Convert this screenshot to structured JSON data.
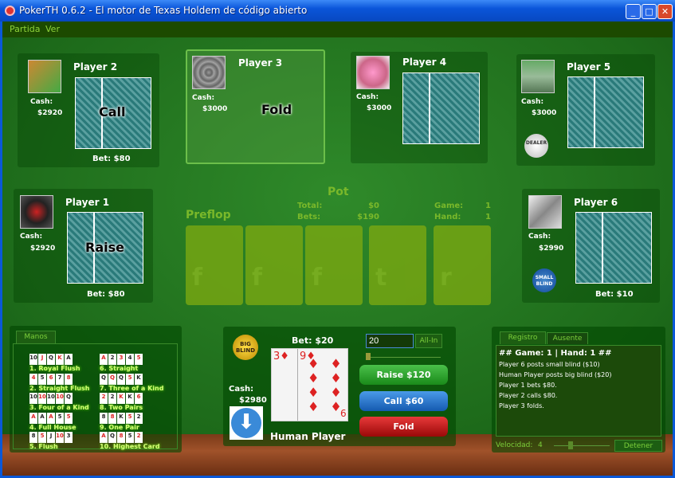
{
  "window": {
    "title": "PokerTH 0.6.2 - El motor de Texas Holdem de código abierto",
    "minimize": "_",
    "maximize": "□",
    "close": "✕"
  },
  "menu": [
    "Partida",
    "Ver"
  ],
  "labels": {
    "cash": "Cash:"
  },
  "players": [
    {
      "name": "Player 1",
      "cash": "$2920",
      "bet": "Bet: $80",
      "action": "Raise"
    },
    {
      "name": "Player 2",
      "cash": "$2920",
      "bet": "Bet: $80",
      "action": "Call"
    },
    {
      "name": "Player 3",
      "cash": "$3000",
      "bet": "",
      "action": "Fold"
    },
    {
      "name": "Player 4",
      "cash": "$3000",
      "bet": "",
      "action": ""
    },
    {
      "name": "Player 5",
      "cash": "$3000",
      "bet": "",
      "action": "",
      "button": "DEALER"
    },
    {
      "name": "Player 6",
      "cash": "$2990",
      "bet": "Bet: $10",
      "action": "",
      "button": "SMALL BLIND"
    }
  ],
  "table": {
    "pot_title": "Pot",
    "round": "Preflop",
    "total_label": "Total:",
    "total": "$0",
    "bets_label": "Bets:",
    "bets": "$190",
    "game_label": "Game:",
    "game": "1",
    "hand_label": "Hand:",
    "hand": "1",
    "board_letters": [
      "f",
      "f",
      "f",
      "t",
      "r"
    ]
  },
  "hands": {
    "tab": "Manos",
    "items": [
      {
        "name": "1. Royal Flush",
        "cards": [
          "10",
          "J",
          "Q",
          "K",
          "A"
        ]
      },
      {
        "name": "2. Straight Flush",
        "cards": [
          "4",
          "5",
          "6",
          "7",
          "8"
        ]
      },
      {
        "name": "3. Four of a Kind",
        "cards": [
          "10",
          "10",
          "10",
          "10",
          "Q"
        ]
      },
      {
        "name": "4. Full House",
        "cards": [
          "A",
          "A",
          "A",
          "5",
          "5"
        ]
      },
      {
        "name": "5. Flush",
        "cards": [
          "8",
          "5",
          "J",
          "10",
          "3"
        ]
      },
      {
        "name": "6. Straight",
        "cards": [
          "A",
          "2",
          "3",
          "4",
          "5"
        ]
      },
      {
        "name": "7. Three of a Kind",
        "cards": [
          "Q",
          "Q",
          "Q",
          "5",
          "K"
        ]
      },
      {
        "name": "8. Two Pairs",
        "cards": [
          "2",
          "2",
          "K",
          "K",
          "6"
        ]
      },
      {
        "name": "9. One Pair",
        "cards": [
          "8",
          "8",
          "K",
          "5",
          "2"
        ]
      },
      {
        "name": "10. Highest Card",
        "cards": [
          "A",
          "Q",
          "8",
          "5",
          "2"
        ]
      }
    ]
  },
  "human": {
    "name": "Human Player",
    "cash": "$2980",
    "bet": "Bet: $20",
    "blind": "BIG BLIND",
    "cards": [
      "3♦",
      "9♦"
    ],
    "card2_bottom": "6",
    "bet_input": "20",
    "allin": "All-In",
    "raise": "Raise $120",
    "call": "Call $60",
    "fold": "Fold"
  },
  "log": {
    "tabs": [
      "Registro",
      "Ausente"
    ],
    "header": "## Game: 1 | Hand: 1 ##",
    "lines": [
      "Player 6 posts small blind ($10)",
      "Human Player posts big blind ($20)",
      "Player 1 bets $80.",
      "Player 2 calls $80.",
      "Player 3 folds."
    ],
    "speed_label": "Velocidad:",
    "speed": "4",
    "stop": "Detener"
  },
  "colors": {
    "felt": "#1d6a1a",
    "raise": "#2a9a2a",
    "call": "#1a6ac0",
    "fold": "#b01010"
  }
}
